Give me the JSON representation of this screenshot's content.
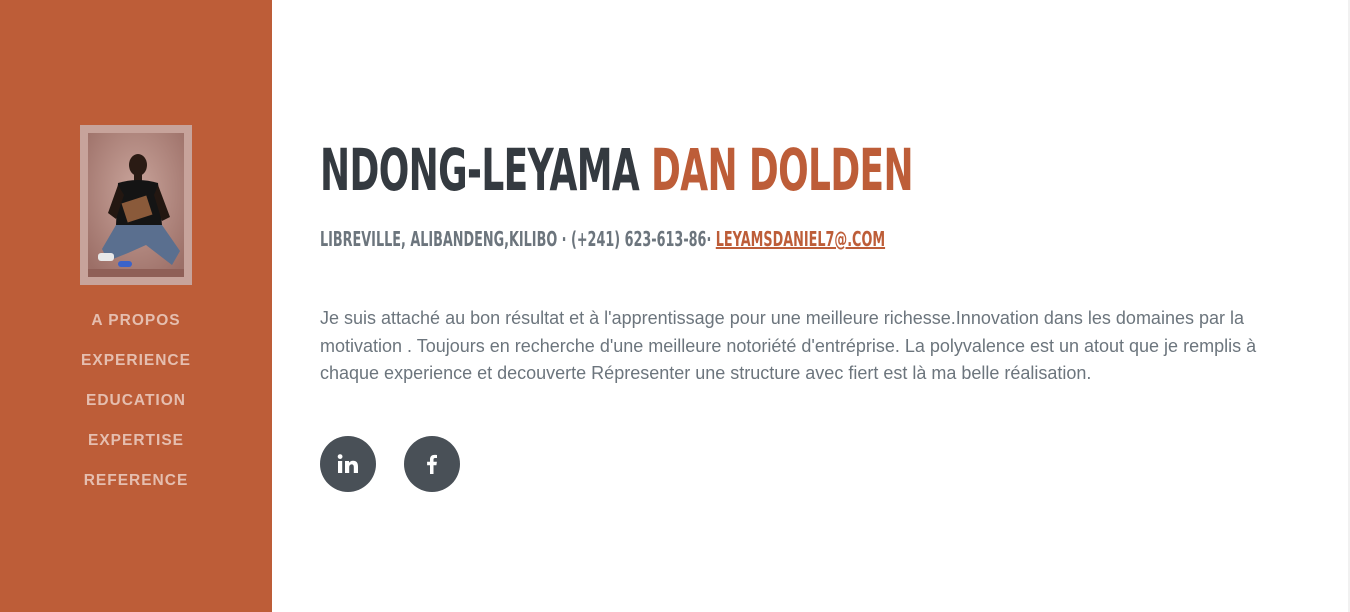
{
  "colors": {
    "primary": "#bd5d38",
    "heading": "#343a40",
    "muted": "#6c757d",
    "social_bg": "#495057"
  },
  "sidebar": {
    "avatar_alt": "",
    "nav": [
      {
        "label": "A PROPOS"
      },
      {
        "label": "EXPERIENCE"
      },
      {
        "label": "EDUCATION"
      },
      {
        "label": "EXPERTISE"
      },
      {
        "label": "REFERENCE"
      }
    ]
  },
  "about": {
    "first_name": "NDONG-LEYAMA",
    "last_name": "DAN DOLDEN",
    "address": "LIBREVILLE, ALIBANDENG,KILIBO · (+241) 623-613-86·",
    "email": "LEYAMSDANIEL7@.COM",
    "lead": "Je suis attaché au bon résultat et à l'apprentissage pour une meilleure richesse.Innovation dans les domaines par la motivation . Toujours en recherche d'une meilleure notoriété d'entréprise. La polyvalence est un atout que je remplis à chaque experience et decouverte Répresenter une structure avec fiert est là ma belle réalisation.",
    "social": [
      {
        "icon": "linkedin-icon"
      },
      {
        "icon": "facebook-icon"
      }
    ]
  }
}
